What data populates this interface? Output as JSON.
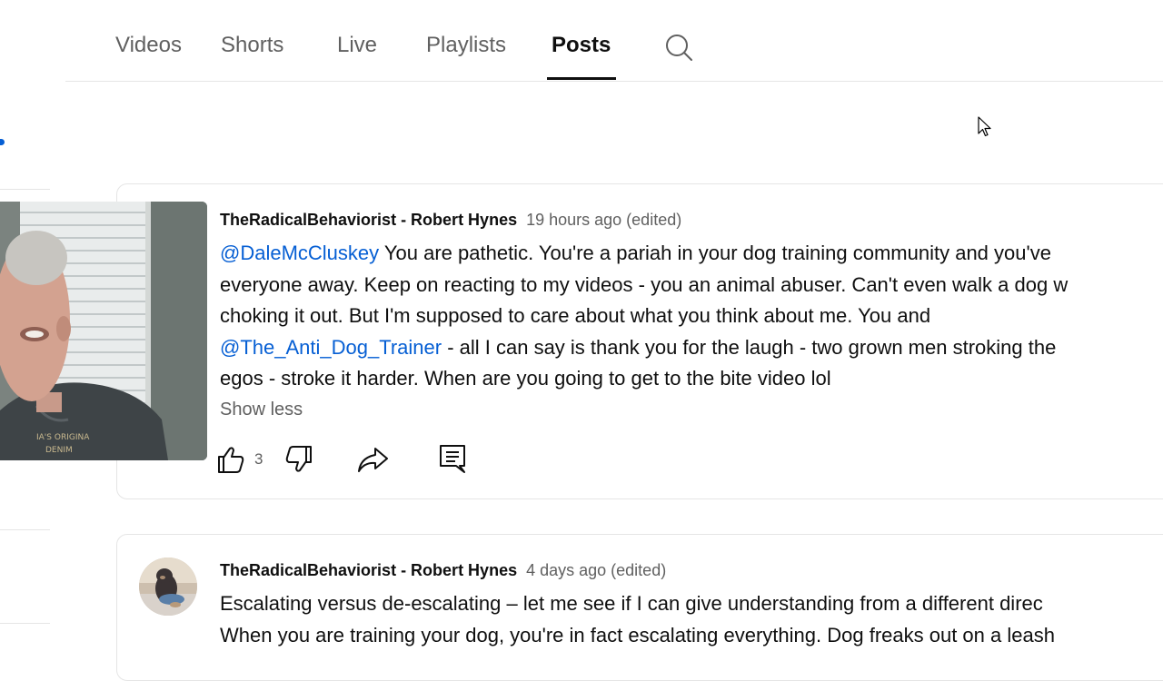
{
  "tabs": [
    {
      "label": "Videos"
    },
    {
      "label": "Shorts"
    },
    {
      "label": "Live"
    },
    {
      "label": "Playlists"
    },
    {
      "label": "Posts"
    }
  ],
  "posts": [
    {
      "author": "TheRadicalBehaviorist - Robert Hynes",
      "time": "19 hours ago (edited)",
      "mention1": "@DaleMcCluskey",
      "line1_rest": " You are pathetic. You're a pariah in your dog training community and you've",
      "line2": "everyone away. Keep on reacting to my videos - you an animal abuser. Can't even walk a dog w",
      "line3": "choking it out. But I'm supposed to care about what you think about me. You and",
      "mention2": "@The_Anti_Dog_Trainer",
      "line4_rest": "  - all I can say is thank you for the laugh - two grown men stroking the",
      "line5": "egos - stroke it harder. When are you going to get to the bite video lol",
      "show_less": "Show less",
      "like_count": "3"
    },
    {
      "author": "TheRadicalBehaviorist - Robert Hynes",
      "time": "4 days ago (edited)",
      "line1": "Escalating versus de-escalating – let me see if I can give understanding from a different direc",
      "line2": "When you are training your dog, you're in fact escalating everything. Dog freaks out on a leash"
    }
  ],
  "colors": {
    "mention": "#065fd4",
    "secondary_text": "#606060",
    "primary_text": "#0f0f0f",
    "divider": "#e5e5e5"
  }
}
